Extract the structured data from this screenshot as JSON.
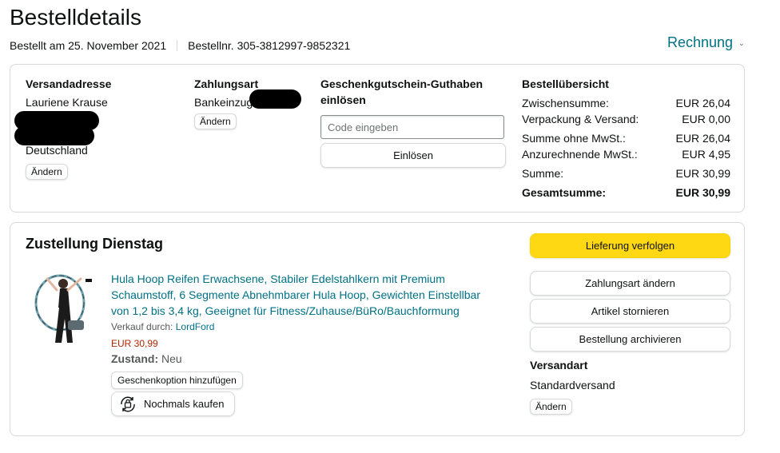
{
  "page": {
    "title": "Bestelldetails",
    "ordered_on": "Bestellt am 25. November 2021",
    "order_number": "Bestellnr. 305-3812997-9852321",
    "invoice_label": "Rechnung"
  },
  "shipping_address": {
    "title": "Versandadresse",
    "name": "Lauriene Krause",
    "country": "Deutschland",
    "change_label": "Ändern"
  },
  "payment": {
    "title": "Zahlungsart",
    "method": "Bankeinzug",
    "change_label": "Ändern"
  },
  "gift_card": {
    "title": "Geschenkgutschein-Guthaben einlösen",
    "placeholder": "Code eingeben",
    "redeem_label": "Einlösen"
  },
  "summary": {
    "title": "Bestellübersicht",
    "rows": [
      {
        "label": "Zwischensumme:",
        "value": "EUR 26,04"
      },
      {
        "label": "Verpackung & Versand:",
        "value": "EUR 0,00"
      },
      {
        "label": "Summe ohne MwSt.:",
        "value": "EUR 26,04"
      },
      {
        "label": "Anzurechnende MwSt.:",
        "value": "EUR 4,95"
      },
      {
        "label": "Summe:",
        "value": "EUR 30,99"
      }
    ],
    "total_label": "Gesamtsumme:",
    "total_value": "EUR 30,99"
  },
  "delivery": {
    "title": "Zustellung Dienstag",
    "product": {
      "name": "Hula Hoop Reifen Erwachsene, Stabiler Edelstahlkern mit Premium Schaumstoff, 6 Segmente Abnehmbarer Hula Hoop, Gewichten Einstellbar von 1,2 bis 3,4 kg, Geeignet für Fitness/Zuhause/BüRo/Bauchformung",
      "sold_by_label": "Verkauf durch:",
      "seller": "LordFord",
      "price": "EUR 30,99",
      "condition_label": "Zustand:",
      "condition_value": "Neu",
      "gift_option_label": "Geschenkoption hinzufügen",
      "buy_again_label": "Nochmals kaufen"
    },
    "actions": {
      "track": "Lieferung verfolgen",
      "change_payment": "Zahlungsart ändern",
      "cancel": "Artikel stornieren",
      "archive": "Bestellung archivieren"
    },
    "shipping_method": {
      "title": "Versandart",
      "value": "Standardversand",
      "change_label": "Ändern"
    }
  },
  "colors": {
    "link": "#007185",
    "price": "#B12704",
    "primary_button": "#FFD814",
    "border": "#D5D9D9"
  }
}
